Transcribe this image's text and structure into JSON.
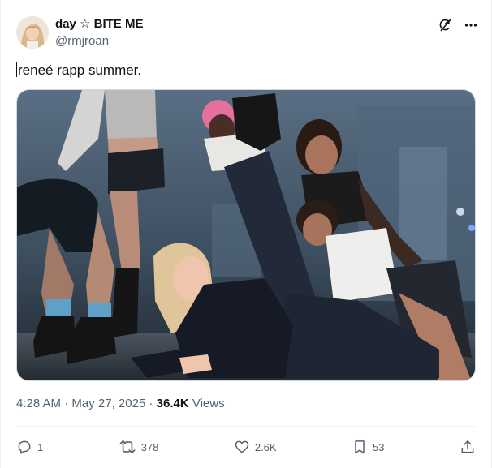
{
  "author": {
    "display_name": "day ☆ BITE ME",
    "handle": "@rmjroan",
    "avatar_icon": "profile-photo"
  },
  "header_icons": [
    "grok-icon",
    "more-icon"
  ],
  "tweet": {
    "text": "reneé rapp summer.",
    "media_alt": "photo"
  },
  "meta": {
    "time": "4:28 AM",
    "separator": "·",
    "date": "May 27, 2025",
    "separator2": "·",
    "views_count": "36.4K",
    "views_label": "Views"
  },
  "actions": {
    "reply_count": "1",
    "retweet_count": "378",
    "like_count": "2.6K",
    "bookmark_count": "53"
  },
  "colors": {
    "text": "#0f1419",
    "secondary": "#536471",
    "border": "#eff3f4"
  }
}
